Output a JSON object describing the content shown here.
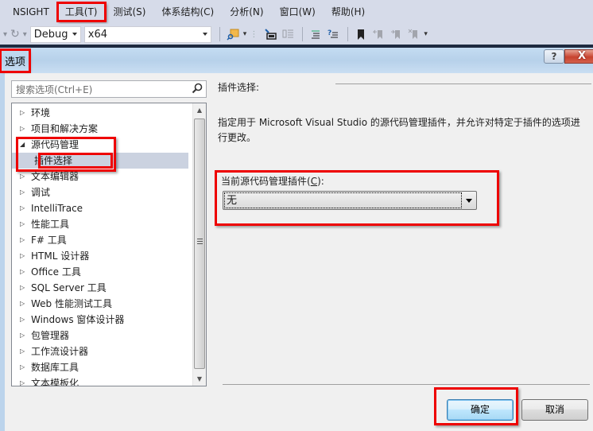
{
  "menubar": {
    "items": [
      {
        "label": "NSIGHT"
      },
      {
        "label": "工具(T)",
        "highlighted": true
      },
      {
        "label": "测试(S)"
      },
      {
        "label": "体系结构(C)"
      },
      {
        "label": "分析(N)"
      },
      {
        "label": "窗口(W)"
      },
      {
        "label": "帮助(H)"
      }
    ]
  },
  "toolbar": {
    "configuration": "Debug",
    "platform": "x64",
    "icons": [
      "find-in-files-icon",
      "go-to-icon",
      "outline-icon",
      "comment-icon",
      "uncomment-icon",
      "bookmark-icon",
      "prev-bookmark-icon",
      "next-bookmark-icon",
      "clear-bookmark-icon"
    ]
  },
  "dialog": {
    "title": "选项",
    "help_label": "?",
    "close_label": "X",
    "search": {
      "placeholder": "搜索选项(Ctrl+E)"
    },
    "tree": {
      "items": [
        {
          "label": "环境",
          "expanded": false
        },
        {
          "label": "项目和解决方案",
          "expanded": false
        },
        {
          "label": "源代码管理",
          "expanded": true
        },
        {
          "label": "插件选择",
          "child": true,
          "selected": true
        },
        {
          "label": "文本编辑器",
          "expanded": false
        },
        {
          "label": "调试",
          "expanded": false
        },
        {
          "label": "IntelliTrace",
          "expanded": false
        },
        {
          "label": "性能工具",
          "expanded": false
        },
        {
          "label": "F# 工具",
          "expanded": false
        },
        {
          "label": "HTML 设计器",
          "expanded": false
        },
        {
          "label": "Office 工具",
          "expanded": false
        },
        {
          "label": "SQL Server 工具",
          "expanded": false
        },
        {
          "label": "Web 性能测试工具",
          "expanded": false
        },
        {
          "label": "Windows 窗体设计器",
          "expanded": false
        },
        {
          "label": "包管理器",
          "expanded": false
        },
        {
          "label": "工作流设计器",
          "expanded": false
        },
        {
          "label": "数据库工具",
          "expanded": false
        },
        {
          "label": "文本模板化",
          "expanded": false
        }
      ]
    },
    "panel": {
      "section_title": "插件选择:",
      "description": "指定用于 Microsoft Visual Studio 的源代码管理插件，并允许对特定于插件的选项进行更改。",
      "plugin_label_prefix": "当前源代码管理插件(",
      "plugin_label_accel": "C",
      "plugin_label_suffix": "):",
      "plugin_value": "无"
    },
    "buttons": {
      "ok": "确定",
      "cancel": "取消"
    }
  },
  "colors": {
    "highlight": "#ee0000",
    "menubar_bg": "#d6dbe9",
    "selected_row": "#cbd2e0"
  }
}
